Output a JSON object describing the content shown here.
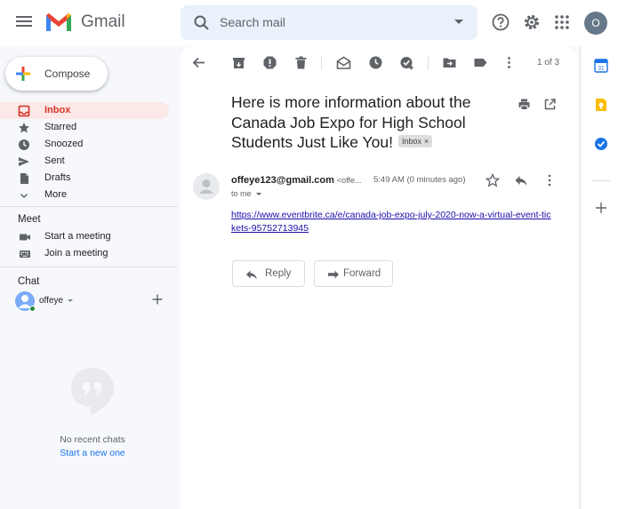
{
  "app": {
    "name": "Gmail"
  },
  "search": {
    "placeholder": "Search mail"
  },
  "header": {
    "avatar_initial": "O"
  },
  "compose": {
    "label": "Compose"
  },
  "nav": {
    "items": [
      {
        "label": "Inbox",
        "icon": "inbox-icon",
        "active": true
      },
      {
        "label": "Starred",
        "icon": "star-icon"
      },
      {
        "label": "Snoozed",
        "icon": "clock-icon"
      },
      {
        "label": "Sent",
        "icon": "send-icon"
      },
      {
        "label": "Drafts",
        "icon": "draft-icon"
      },
      {
        "label": "More",
        "icon": "chevron-down-icon"
      }
    ]
  },
  "meet": {
    "title": "Meet",
    "items": [
      {
        "label": "Start a meeting",
        "icon": "video-icon"
      },
      {
        "label": "Join a meeting",
        "icon": "keyboard-icon"
      }
    ]
  },
  "chat": {
    "title": "Chat",
    "user": "offeye",
    "empty_text": "No recent chats",
    "start_link": "Start a new one"
  },
  "toolbar": {
    "pager": "1 of 3"
  },
  "email": {
    "subject": "Here is more information about the Canada Job Expo for High School Students Just Like You!",
    "label_chip": "Inbox",
    "chip_close": "×",
    "sender_name": "offeye123@gmail.com",
    "sender_email": "<offe...",
    "time": "5:49 AM (0 minutes ago)",
    "to": "to me",
    "link": "https://www.eventbrite.ca/e/canada-job-expo-july-2020-now-a-virtual-event-tickets-95752713945",
    "reply_label": "Reply",
    "forward_label": "Forward"
  },
  "colors": {
    "accent_red": "#d93025",
    "active_bg": "#fce8e6",
    "link_blue": "#1a73e8",
    "search_bg": "#eaf1fb"
  }
}
